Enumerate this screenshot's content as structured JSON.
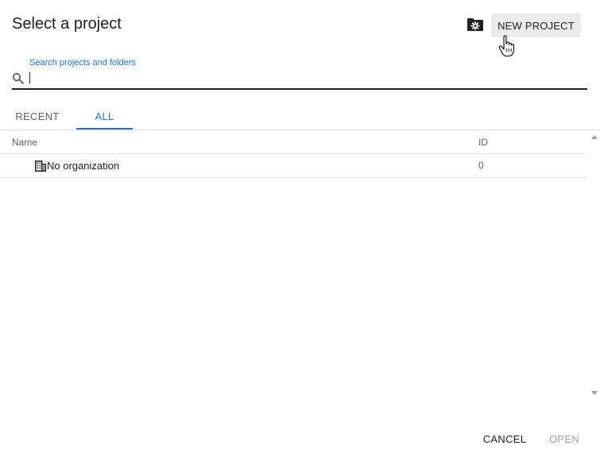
{
  "dialog": {
    "title": "Select a project",
    "new_project_label": "NEW PROJECT",
    "folder_settings_icon": "folder-settings-icon",
    "cursor_icon": "hand-pointer-icon"
  },
  "search": {
    "label": "Search projects and folders",
    "value": "",
    "icon": "search-icon"
  },
  "tabs": [
    {
      "label": "RECENT",
      "selected": false
    },
    {
      "label": "ALL",
      "selected": true
    }
  ],
  "table": {
    "columns": [
      "Name",
      "ID"
    ],
    "rows": [
      {
        "icon": "organization-icon",
        "name": "No organization",
        "id": "0"
      }
    ]
  },
  "footer": {
    "cancel_label": "CANCEL",
    "open_label": "OPEN"
  },
  "colors": {
    "accent": "#1a73e8",
    "text": "#202124",
    "muted": "#5f6368",
    "disabled": "#9e9e9e",
    "button_bg": "#ececec"
  }
}
